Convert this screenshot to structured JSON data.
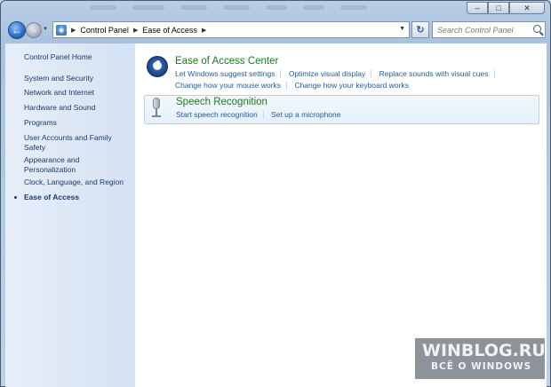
{
  "window": {
    "caption_buttons": {
      "minimize": "–",
      "maximize": "□",
      "close": "✕"
    }
  },
  "navigation": {
    "back_glyph": "←",
    "forward_glyph": "→",
    "history_glyph": "▼",
    "breadcrumb": [
      "Control Panel",
      "Ease of Access"
    ],
    "dropdown_glyph": "▼",
    "refresh_glyph": "↻",
    "search_placeholder": "Search Control Panel"
  },
  "sidebar": {
    "items": [
      {
        "label": "Control Panel Home"
      },
      {
        "label": "System and Security"
      },
      {
        "label": "Network and Internet"
      },
      {
        "label": "Hardware and Sound"
      },
      {
        "label": "Programs"
      },
      {
        "label": "User Accounts and Family Safety"
      },
      {
        "label": "Appearance and Personalization"
      },
      {
        "label": "Clock, Language, and Region"
      },
      {
        "label": "Ease of Access",
        "active": true
      }
    ]
  },
  "main": {
    "categories": [
      {
        "title": "Ease of Access Center",
        "icon": "ease-of-access-icon",
        "links_row1": [
          "Let Windows suggest settings",
          "Optimize visual display",
          "Replace sounds with visual cues"
        ],
        "links_row2": [
          "Change how your mouse works",
          "Change how your keyboard works"
        ]
      },
      {
        "title": "Speech Recognition",
        "icon": "microphone-icon",
        "links_row1": [
          "Start speech recognition",
          "Set up a microphone"
        ]
      }
    ]
  },
  "watermark": {
    "title": "WINBLOG.RU",
    "subtitle": "ВСЁ О WINDOWS"
  },
  "colors": {
    "link": "#1c5ea8",
    "category_title": "#1e7a1e",
    "sidebar_text": "#1c3a6b"
  }
}
